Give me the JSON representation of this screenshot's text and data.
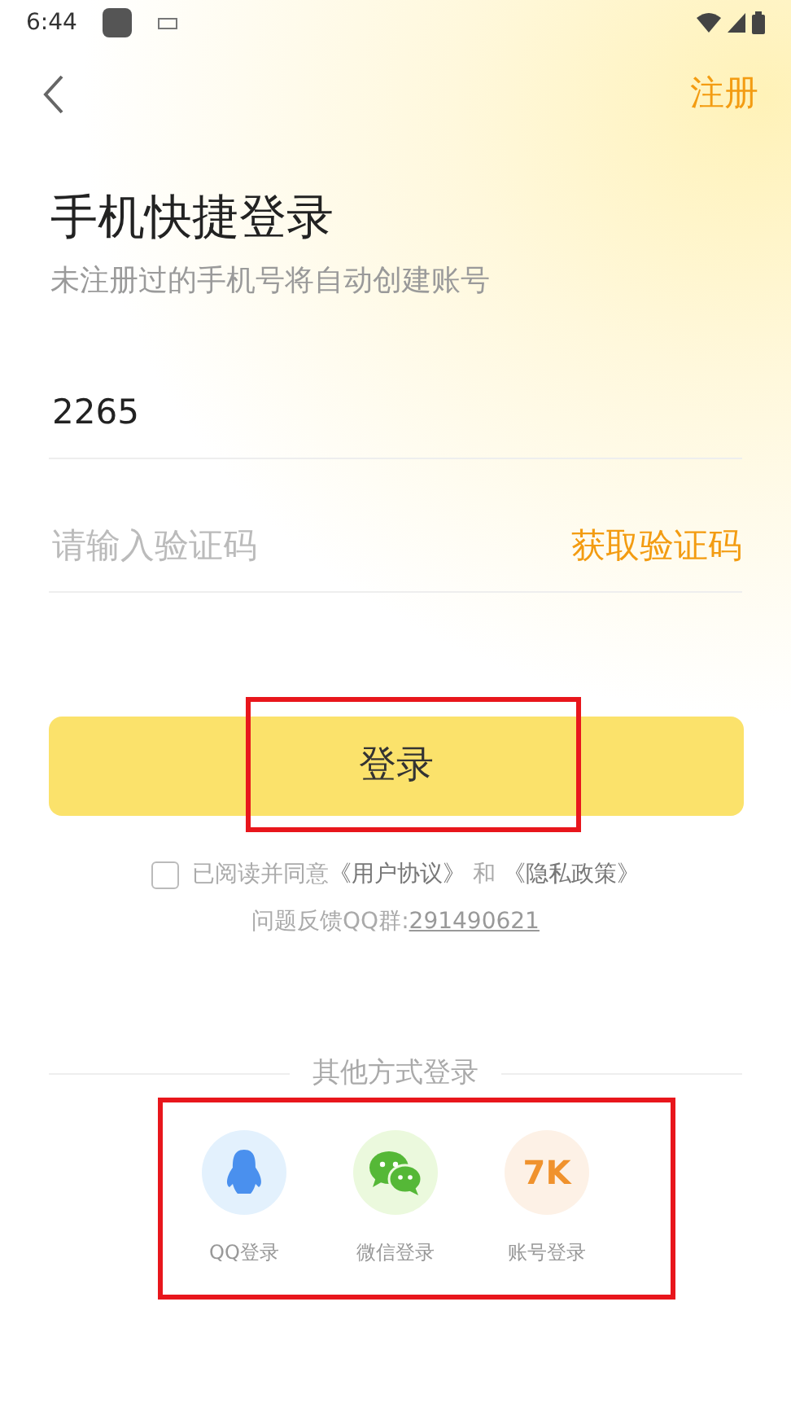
{
  "status_bar": {
    "time": "6:44"
  },
  "header": {
    "register_link": "注册"
  },
  "title": "手机快捷登录",
  "subtitle": "未注册过的手机号将自动创建账号",
  "phone_field": {
    "value": "2265"
  },
  "code_field": {
    "placeholder": "请输入验证码",
    "get_code_button": "获取验证码"
  },
  "login_button": {
    "label": "登录",
    "highlighted": true
  },
  "agreement": {
    "checked": false,
    "prefix": "已阅读并同意",
    "user_agreement": "《用户协议》",
    "joiner": "和",
    "privacy_policy": "《隐私政策》"
  },
  "feedback": {
    "label": "问题反馈QQ群:",
    "group_number": "291490621"
  },
  "other_logins": {
    "heading": "其他方式登录",
    "highlighted": true,
    "options": [
      {
        "kind": "qq",
        "label": "QQ登录"
      },
      {
        "kind": "wechat",
        "label": "微信登录"
      },
      {
        "kind": "account",
        "badge": "7K",
        "label": "账号登录"
      }
    ]
  }
}
